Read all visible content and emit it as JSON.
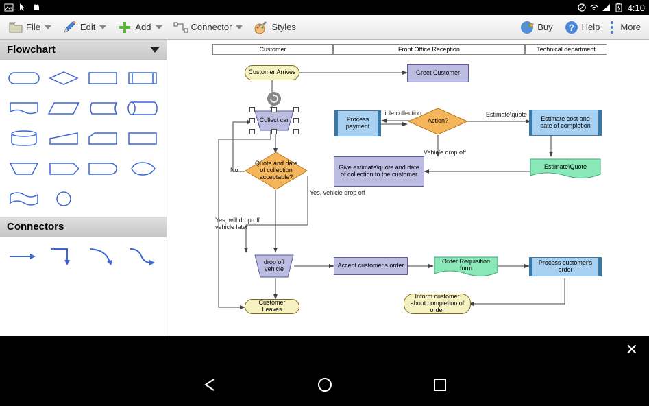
{
  "status": {
    "time": "4:10"
  },
  "toolbar": {
    "file": "File",
    "edit": "Edit",
    "add": "Add",
    "connector": "Connector",
    "styles": "Styles",
    "buy": "Buy",
    "help": "Help",
    "more": "More"
  },
  "sidebar": {
    "flowchart_header": "Flowchart",
    "connectors_header": "Connectors"
  },
  "swimlanes": {
    "customer": "Customer",
    "front_office": "Front Office Reception",
    "technical": "Technical department"
  },
  "nodes": {
    "customer_arrives": "Customer Arrives",
    "greet_customer": "Greet Customer",
    "collect_car": "Collect car",
    "process_payment": "Process payment",
    "action": "Action?",
    "estimate_cost": "Estimate cost and date of completion",
    "quote_acceptable": "Quote and date of collection acceptable?",
    "give_estimate": "Give estimate\\quote and date of collection to the customer",
    "estimate_quote": "Estimate\\Quote",
    "drop_off_vehicle": "drop off vehicle",
    "accept_order": "Accept customer's order",
    "order_requisition": "Order Requisition form",
    "process_order": "Process customer's order",
    "customer_leaves": "Customer Leaves",
    "inform_customer": "Inform customer about completion of order"
  },
  "labels": {
    "vehicle_collection": "Vehicle collection",
    "estimate_quote": "Estimate\\quote",
    "vehicle_drop_off": "Vehicle drop off",
    "no": "No",
    "yes_drop_off": "Yes, will drop off vehicle later",
    "yes_vehicle_drop": "Yes, vehicle drop off"
  },
  "colors": {
    "yellow_fill": "#f6f1c0",
    "yellow_stroke": "#7a6c1e",
    "purple_fill": "#bcbce0",
    "purple_stroke": "#5c5c9e",
    "blue_fill": "#a8d0f0",
    "blue_stroke": "#3a78a8",
    "orange_fill": "#f5b55a",
    "orange_stroke": "#b87820",
    "green_fill": "#8ae8b8",
    "green_stroke": "#3ea878",
    "shape_blue": "#3a66d6"
  }
}
